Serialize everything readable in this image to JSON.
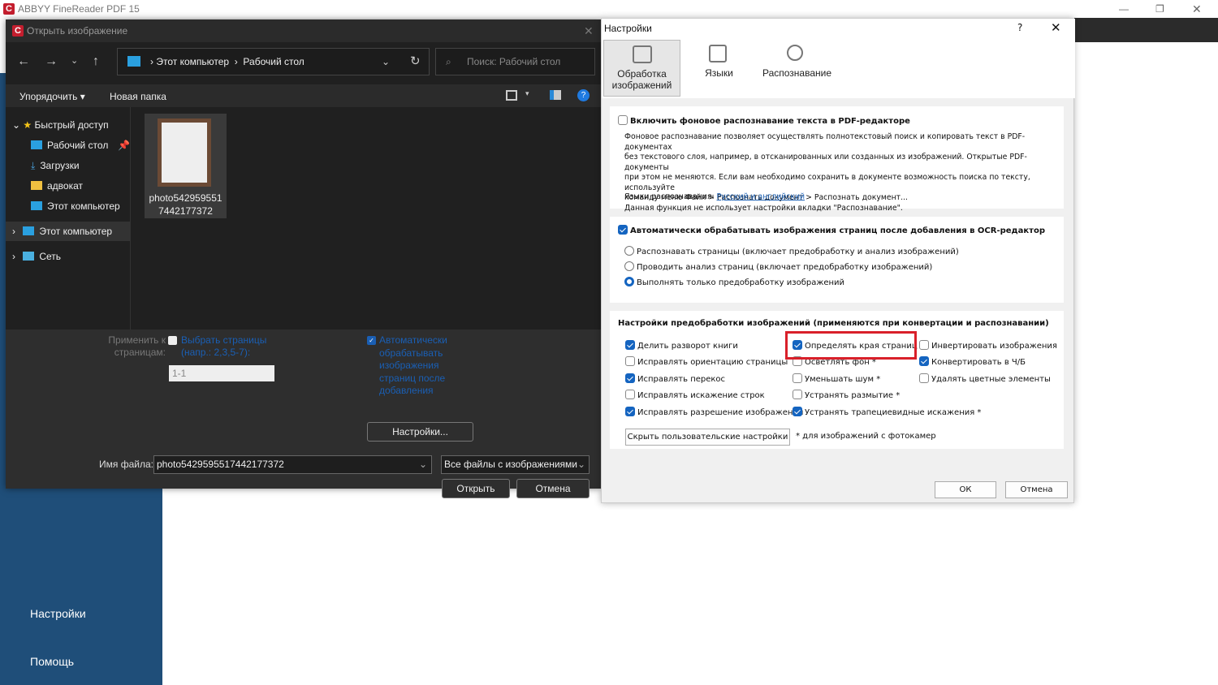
{
  "app": {
    "title": "ABBYY FineReader PDF 15",
    "sidebar": [
      "Настройки",
      "Помощь"
    ]
  },
  "open_dialog": {
    "title": "Открыть изображение",
    "breadcrumb": [
      "Этот компьютер",
      "Рабочий стол"
    ],
    "search_placeholder": "Поиск: Рабочий стол",
    "toolbar": {
      "organize": "Упорядочить",
      "new_folder": "Новая папка"
    },
    "tree": [
      "Быстрый доступ",
      "Рабочий стол",
      "Загрузки",
      "адвокат",
      "Этот компьютер",
      "Этот компьютер",
      "Сеть"
    ],
    "file": {
      "name_line1": "photo542959551",
      "name_line2": "7442177372"
    },
    "apply_label1": "Применить к",
    "apply_label2": "страницам:",
    "select_pages1": "Выбрать страницы",
    "select_pages2": "(напр.: 2,3,5-7):",
    "pages_value": "1-1",
    "auto_process": [
      "Автоматически",
      "обрабатывать",
      "изображения",
      "страниц после",
      "добавления"
    ],
    "settings_button": "Настройки...",
    "filename_label": "Имя файла:",
    "filename_value": "photo5429595517442177372",
    "filetype": "Все файлы с изображениями",
    "open_button": "Открыть",
    "cancel_button": "Отмена"
  },
  "settings": {
    "title": "Настройки",
    "help": "?",
    "tabs": [
      "Обработка изображений",
      "Языки",
      "Распознавание"
    ],
    "bg_ocr": {
      "label": "Включить фоновое распознавание текста в PDF-редакторе",
      "checked": false,
      "desc": [
        "Фоновое распознавание позволяет осуществлять полнотекстовый поиск и копировать текст в PDF-документах",
        "без текстового слоя, например, в отсканированных или созданных из изображений. Открытые PDF-документы",
        "при этом не меняются. Если вам необходимо сохранить в документе возможность поиска по тексту, используйте",
        "команду меню Файл > Распознать документ > Распознать документ...",
        "Данная функция не использует настройки вкладки \"Распознавание\"."
      ],
      "lang_label": "Языки распознавания:",
      "lang_link": "Русский и английский"
    },
    "auto": {
      "label": "Автоматически обрабатывать изображения страниц после добавления в OCR-редактор",
      "checked": true,
      "options": [
        "Распознавать страницы (включает предобработку и анализ изображений)",
        "Проводить анализ страниц (включает предобработку изображений)",
        "Выполнять только предобработку изображений"
      ],
      "selected": 2
    },
    "pre": {
      "title": "Настройки предобработки изображений (применяются при конвертации и распознавании)",
      "col1": [
        {
          "label": "Делить разворот книги",
          "checked": true
        },
        {
          "label": "Исправлять ориентацию страницы",
          "checked": false
        },
        {
          "label": "Исправлять перекос",
          "checked": true
        },
        {
          "label": "Исправлять искажение строк",
          "checked": false
        },
        {
          "label": "Исправлять разрешение изображений",
          "checked": true
        }
      ],
      "col2": [
        {
          "label": "Определять края страниц *",
          "checked": true
        },
        {
          "label": "Осветлять фон *",
          "checked": false
        },
        {
          "label": "Уменьшать шум *",
          "checked": false
        },
        {
          "label": "Устранять размытие *",
          "checked": false
        },
        {
          "label": "Устранять трапециевидные искажения *",
          "checked": true
        }
      ],
      "col3": [
        {
          "label": "Инвертировать изображения",
          "checked": false
        },
        {
          "label": "Конвертировать в Ч/Б",
          "checked": true
        },
        {
          "label": "Удалять цветные элементы",
          "checked": false
        }
      ],
      "hide_button": "Скрыть пользовательские настройки",
      "note": "* для изображений с фотокамер"
    },
    "ok": "ОК",
    "cancel": "Отмена",
    "highlight_color": "#d9202a"
  }
}
